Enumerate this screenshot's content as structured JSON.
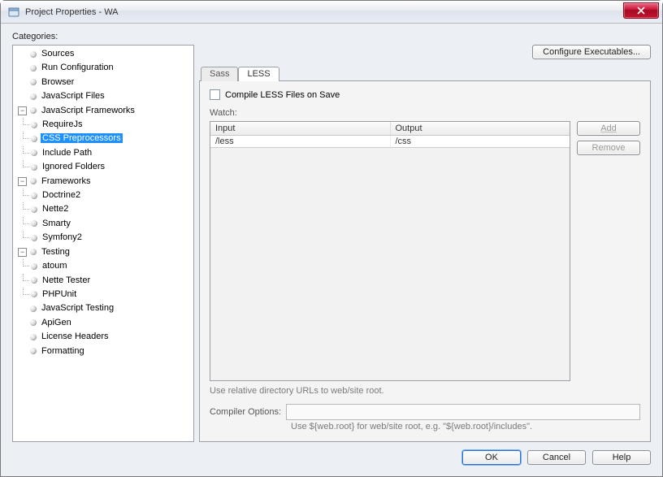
{
  "window": {
    "title": "Project Properties - WA"
  },
  "labels": {
    "categories": "Categories:"
  },
  "tree": {
    "items": [
      "Sources",
      "Run Configuration",
      "Browser",
      "JavaScript Files"
    ],
    "jsframeworks": {
      "label": "JavaScript Frameworks",
      "children": [
        "RequireJs",
        "CSS Preprocessors",
        "Include Path",
        "Ignored Folders"
      ],
      "selected_index": 1
    },
    "frameworks": {
      "label": "Frameworks",
      "children": [
        "Doctrine2",
        "Nette2",
        "Smarty",
        "Symfony2"
      ]
    },
    "testing": {
      "label": "Testing",
      "children": [
        "atoum",
        "Nette Tester",
        "PHPUnit"
      ]
    },
    "rest": [
      "JavaScript Testing",
      "ApiGen",
      "License Headers",
      "Formatting"
    ]
  },
  "right": {
    "configure_exec": "Configure Executables...",
    "tabs": {
      "sass": "Sass",
      "less": "LESS"
    },
    "compile_on_save": "Compile LESS Files on Save",
    "watch_label": "Watch:",
    "table": {
      "headers": {
        "input": "Input",
        "output": "Output"
      },
      "rows": [
        {
          "input": "/less",
          "output": "/css"
        }
      ]
    },
    "add_btn": "Add",
    "remove_btn": "Remove",
    "url_hint": "Use relative directory URLs to web/site root.",
    "compiler_options_label": "Compiler Options:",
    "compiler_options_value": "",
    "compiler_hint": "Use ${web.root} for web/site root, e.g. \"${web.root}/includes\"."
  },
  "footer": {
    "ok": "OK",
    "cancel": "Cancel",
    "help": "Help"
  }
}
